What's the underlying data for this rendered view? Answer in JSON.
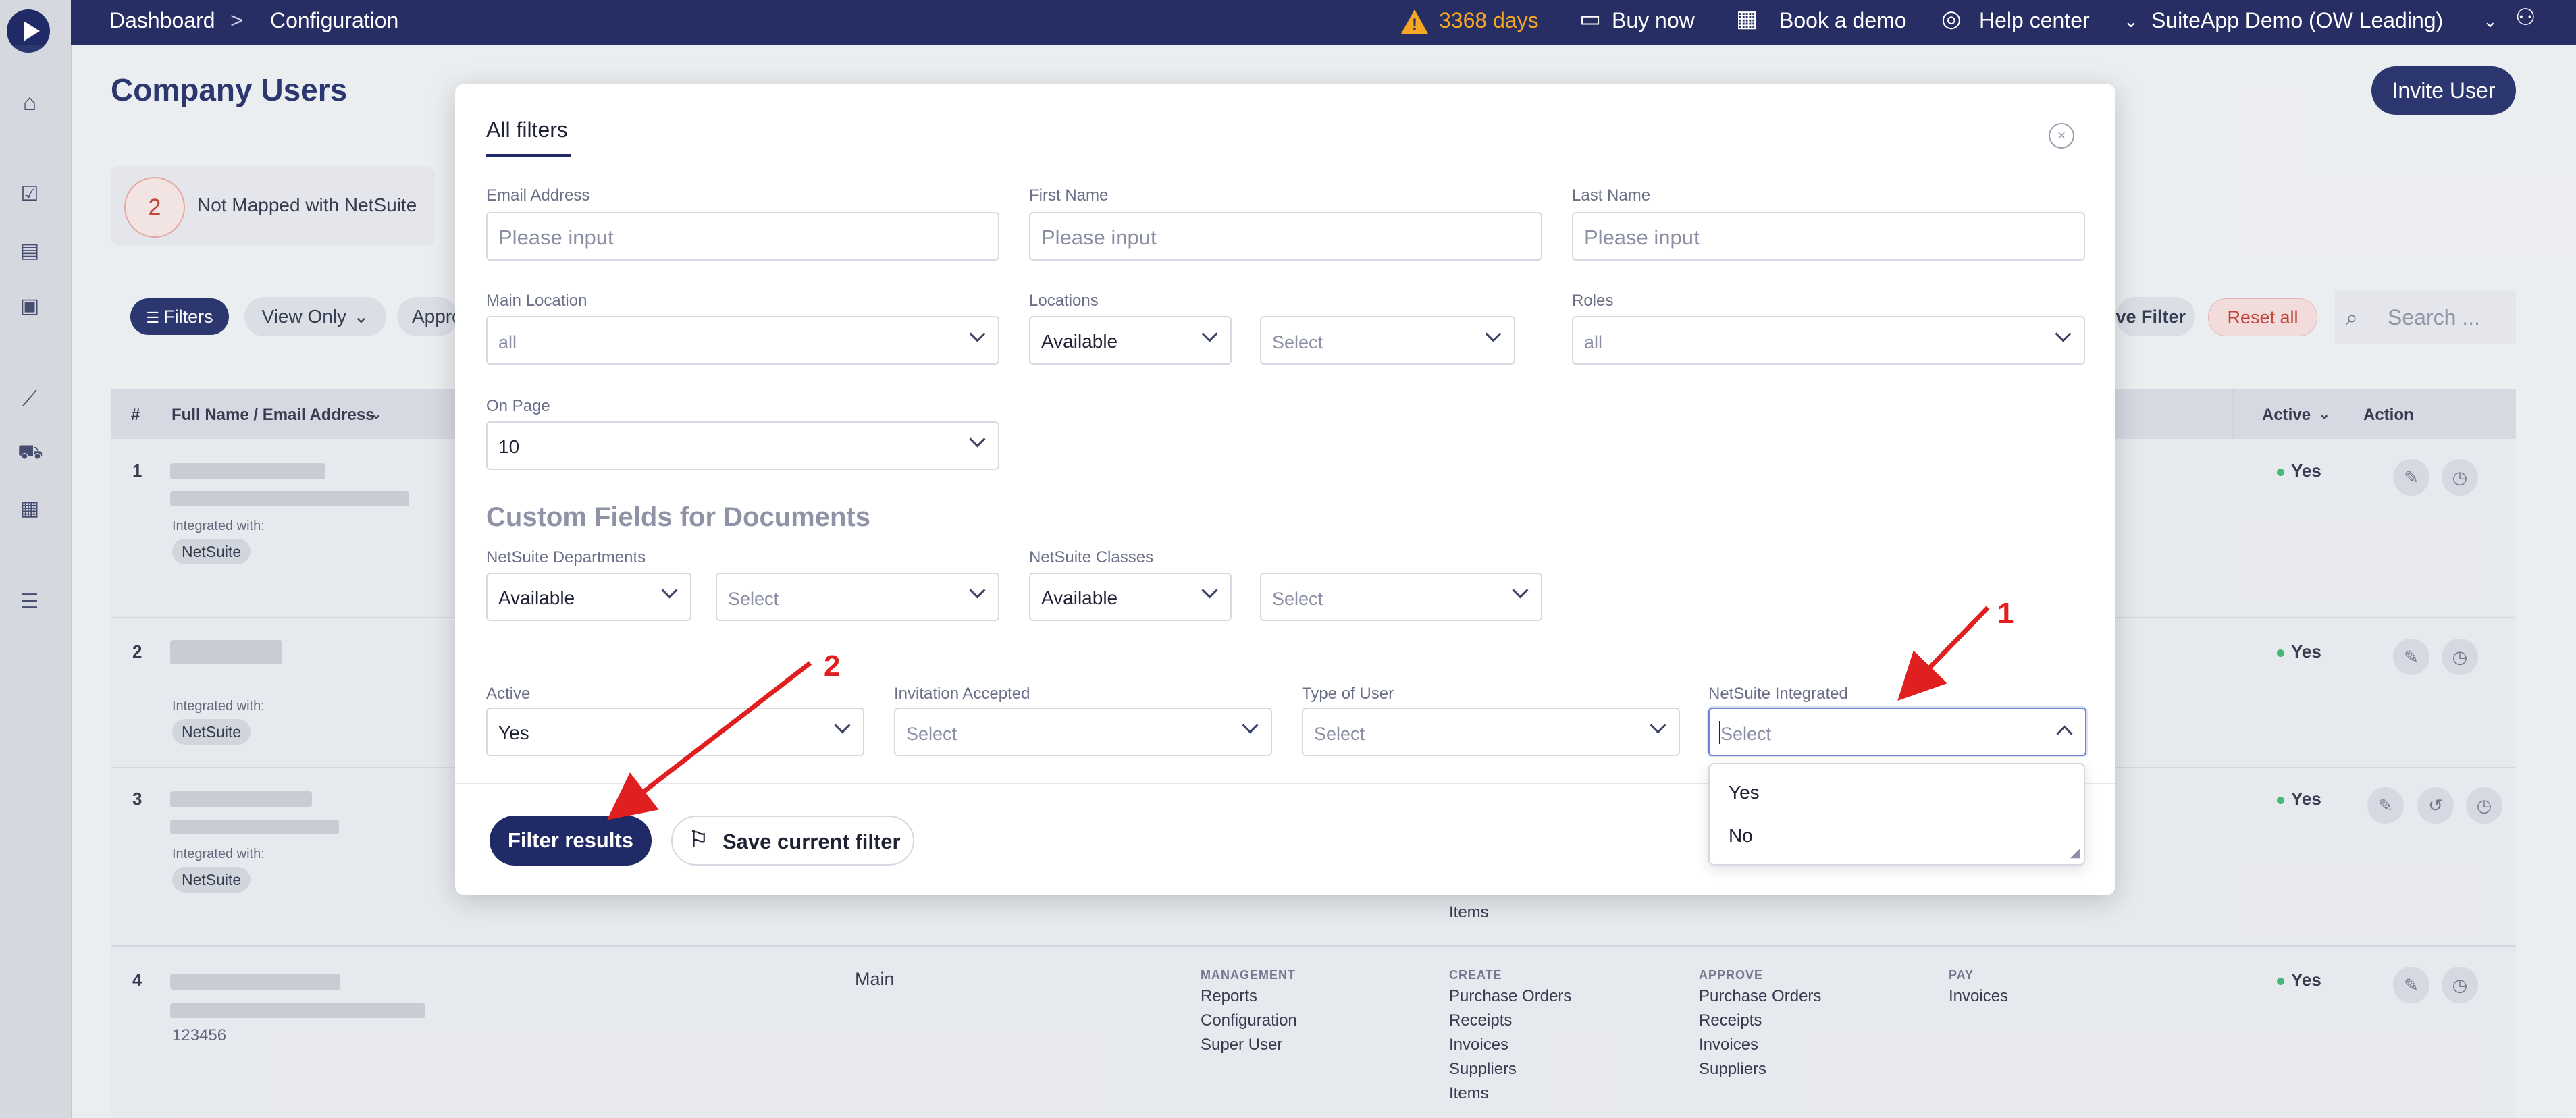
{
  "topbar": {
    "breadcrumb_home": "Dashboard",
    "breadcrumb_sep": ">",
    "breadcrumb_current": "Configuration",
    "trial_days": "3368 days",
    "buy_now": "Buy now",
    "book_demo": "Book a demo",
    "help_center": "Help center",
    "account": "SuiteApp Demo (OW Leading)"
  },
  "page": {
    "title": "Company Users",
    "invite_button": "Invite User",
    "summary_count": "2",
    "summary_label": "Not Mapped with NetSuite",
    "filters_button": "Filters",
    "view_only": "View Only",
    "approver_partial": "Appro",
    "save_filter_partial": "ve Filter",
    "reset_all": "Reset all",
    "search_placeholder": "Search ..."
  },
  "table": {
    "headers": {
      "num": "#",
      "name": "Full Name / Email Address",
      "active": "Active",
      "action": "Action"
    },
    "integrated_label": "Integrated with:",
    "netsuite_tag": "NetSuite",
    "rows": [
      {
        "num": "1",
        "active": "Yes"
      },
      {
        "num": "2",
        "active": "Yes"
      },
      {
        "num": "3",
        "active": "Yes"
      },
      {
        "num": "4",
        "active": "Yes",
        "extra": "123456",
        "location": "Main"
      }
    ],
    "row3_tail": [
      "Items"
    ],
    "row4": {
      "management_head": "MANAGEMENT",
      "management": [
        "Reports",
        "Configuration",
        "Super User"
      ],
      "create_head": "CREATE",
      "create": [
        "Purchase Orders",
        "Receipts",
        "Invoices",
        "Suppliers",
        "Items"
      ],
      "approve_head": "APPROVE",
      "approve": [
        "Purchase Orders",
        "Receipts",
        "Invoices",
        "Suppliers"
      ],
      "pay_head": "PAY",
      "pay": [
        "Invoices"
      ]
    }
  },
  "modal": {
    "tab": "All filters",
    "email_label": "Email Address",
    "email_placeholder": "Please input",
    "first_label": "First Name",
    "first_placeholder": "Please input",
    "last_label": "Last Name",
    "last_placeholder": "Please input",
    "main_location_label": "Main Location",
    "main_location_value": "all",
    "locations_label": "Locations",
    "locations_mode": "Available",
    "locations_select": "Select",
    "roles_label": "Roles",
    "roles_value": "all",
    "on_page_label": "On Page",
    "on_page_value": "10",
    "custom_section": "Custom Fields for Documents",
    "departments_label": "NetSuite Departments",
    "departments_mode": "Available",
    "departments_select": "Select",
    "classes_label": "NetSuite Classes",
    "classes_mode": "Available",
    "classes_select": "Select",
    "active_label": "Active",
    "active_value": "Yes",
    "invitation_label": "Invitation Accepted",
    "invitation_value": "Select",
    "type_label": "Type of User",
    "type_value": "Select",
    "netsuite_label": "NetSuite Integrated",
    "netsuite_placeholder": "Select",
    "netsuite_options": [
      "Yes",
      "No"
    ],
    "filter_button": "Filter results",
    "save_button": "Save current filter"
  },
  "annotations": [
    "1",
    "2"
  ],
  "colors": {
    "navy": "#1f2a66",
    "topbar": "#262e63",
    "warning": "#f5a623",
    "danger": "#c0392b",
    "arrow": "#e02020"
  }
}
